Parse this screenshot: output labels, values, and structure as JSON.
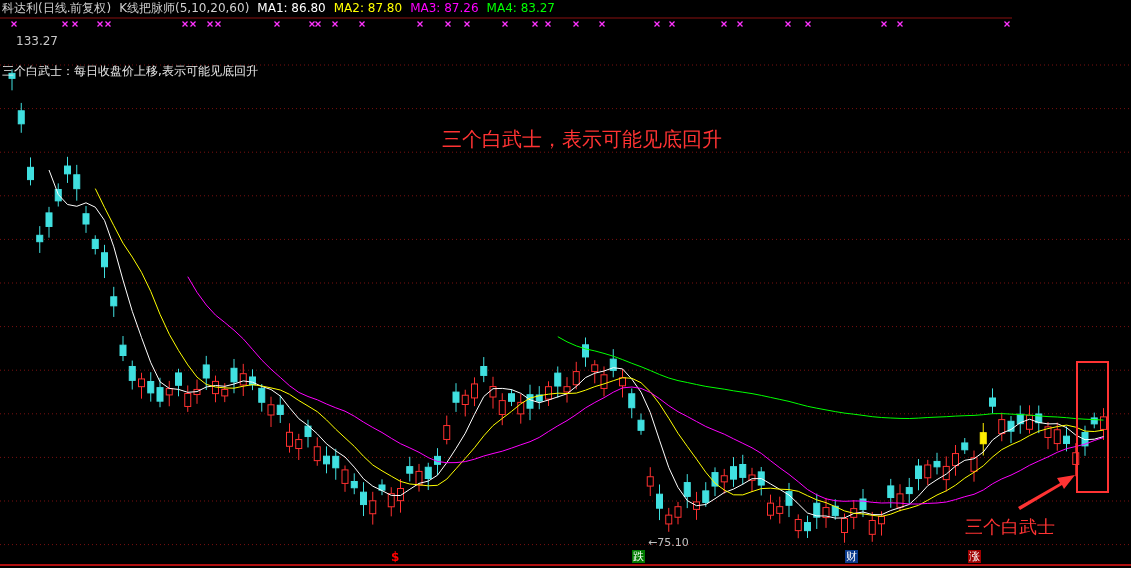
{
  "header": {
    "stock_title": "科达利(日线.前复权)",
    "indicator": "K线把脉师(5,10,20,60)",
    "moving_averages": [
      {
        "label": "MA1: 86.80",
        "color": "#ffffff"
      },
      {
        "label": "MA2: 87.80",
        "color": "#ffff00"
      },
      {
        "label": "MA3: 87.26",
        "color": "#ff00ff"
      },
      {
        "label": "MA4: 83.27",
        "color": "#00ff00"
      }
    ]
  },
  "chart": {
    "high_label": "133.27",
    "pattern_note": "三个白武士：每日收盘价上移,表示可能见底回升",
    "headline": "三个白武士，表示可能见底回升",
    "low_label": "←75.10",
    "callout": "三个白武士",
    "event_markers": [
      {
        "symbol": "$",
        "kind": "plain",
        "color": "#ff0000"
      },
      {
        "symbol": "跌",
        "kind": "badge",
        "color": "#007a00"
      },
      {
        "symbol": "财",
        "kind": "badge",
        "color": "#0a3a8c"
      },
      {
        "symbol": "涨",
        "kind": "badge",
        "color": "#a00000"
      }
    ]
  }
}
